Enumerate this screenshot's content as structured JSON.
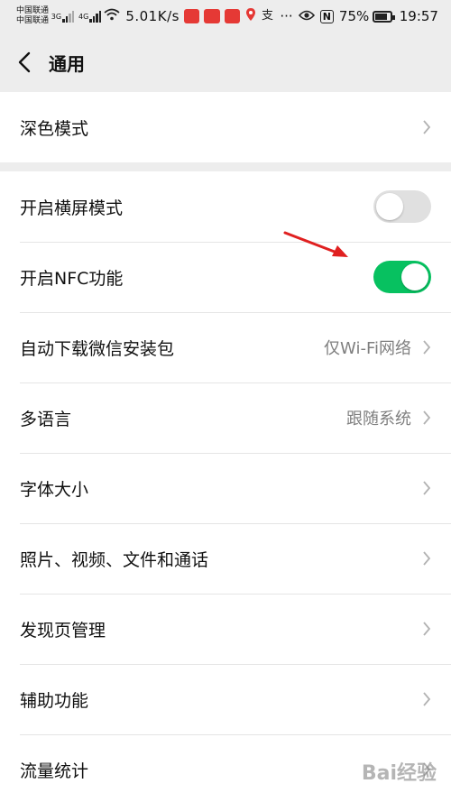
{
  "status_bar": {
    "carrier_1": "中国联通",
    "carrier_2": "中国联通",
    "sig_1": "3G",
    "sig_2": "4G",
    "net_speed": "5.01K/s",
    "app_icons": [
      "sina-weibo-icon",
      "taobao-icon",
      "ecommerce-icon"
    ],
    "more": "···",
    "nfc": "N",
    "battery_pct": "75%",
    "time": "19:57"
  },
  "header": {
    "title": "通用"
  },
  "sections": [
    {
      "rows": [
        {
          "label": "深色模式",
          "type": "chevron"
        }
      ]
    },
    {
      "rows": [
        {
          "label": "开启横屏模式",
          "type": "toggle",
          "state": "off"
        },
        {
          "label": "开启NFC功能",
          "type": "toggle",
          "state": "on"
        },
        {
          "label": "自动下载微信安装包",
          "type": "chevron",
          "value": "仅Wi-Fi网络"
        },
        {
          "label": "多语言",
          "type": "chevron",
          "value": "跟随系统"
        },
        {
          "label": "字体大小",
          "type": "chevron"
        },
        {
          "label": "照片、视频、文件和通话",
          "type": "chevron"
        },
        {
          "label": "发现页管理",
          "type": "chevron"
        },
        {
          "label": "辅助功能",
          "type": "chevron"
        },
        {
          "label": "流量统计",
          "type": "chevron"
        }
      ]
    }
  ],
  "colors": {
    "accent": "#07c160",
    "annotation": "#e02020",
    "background": "#ededed"
  },
  "watermark": "Bai经验"
}
